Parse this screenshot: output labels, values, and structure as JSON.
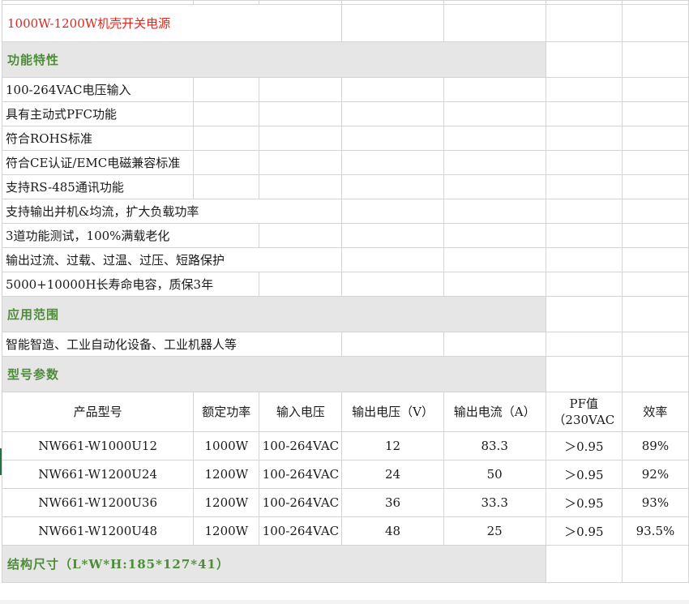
{
  "title": "1000W-1200W机壳开关电源",
  "sections": {
    "features": "功能特性",
    "applications": "应用范围",
    "models": "型号参数",
    "dimensions": "结构尺寸（L*W*H:185*127*41）"
  },
  "features": [
    "100-264VAC电压输入",
    "具有主动式PFC功能",
    "符合ROHS标准",
    "符合CE认证/EMC电磁兼容标准",
    "支持RS-485通讯功能",
    "支持输出并机&均流，扩大负载功率",
    "3道功能测试，100%满载老化",
    "输出过流、过载、过温、过压、短路保护",
    "5000+10000H长寿命电容，质保3年"
  ],
  "application": "智能智造、工业自动化设备、工业机器人等",
  "table": {
    "headers": [
      "产品型号",
      "额定功率",
      "输入电压",
      "输出电压（V）",
      "输出电流（A）",
      "PF值",
      "（230VAC",
      "效率"
    ],
    "rows": [
      [
        "NW661-W1000U12",
        "1000W",
        "100-264VAC",
        "12",
        "83.3",
        "＞0.95",
        "89%"
      ],
      [
        "NW661-W1200U24",
        "1200W",
        "100-264VAC",
        "24",
        "50",
        "＞0.95",
        "92%"
      ],
      [
        "NW661-W1200U36",
        "1200W",
        "100-264VAC",
        "36",
        "33.3",
        "＞0.95",
        "93%"
      ],
      [
        "NW661-W1200U48",
        "1200W",
        "100-264VAC",
        "48",
        "25",
        "＞0.95",
        "93.5%"
      ]
    ]
  },
  "colors": {
    "title": "#e0261b",
    "section_text": "#4e8c39",
    "section_fill": "#e6e6e6",
    "gridline": "#d4d4d4"
  }
}
